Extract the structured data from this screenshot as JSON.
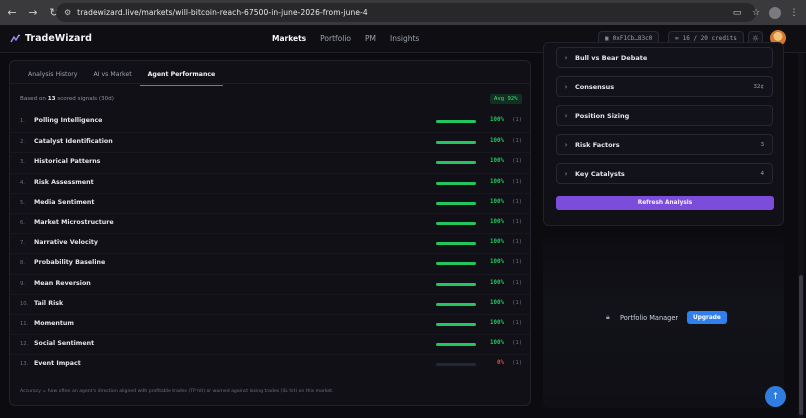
{
  "browser": {
    "url": "tradewizard.live/markets/will-bitcoin-reach-67500-in-june-2026-from-june-4"
  },
  "header": {
    "brand": "TradeWizard",
    "nav": [
      {
        "label": "Markets",
        "active": true
      },
      {
        "label": "Portfolio",
        "active": false
      },
      {
        "label": "PM",
        "active": false
      },
      {
        "label": "Insights",
        "active": false
      }
    ],
    "wallet": "0xF1Cb…83c0",
    "credits": "16 / 20 credits"
  },
  "tabs": [
    {
      "label": "Analysis History",
      "active": false
    },
    {
      "label": "AI vs Market",
      "active": false
    },
    {
      "label": "Agent Performance",
      "active": true
    }
  ],
  "summary": {
    "prefix": "Based on",
    "count": "13",
    "suffix": "scored signals (30d)",
    "avg_badge": "Avg 92%"
  },
  "agents": [
    {
      "num": "1.",
      "name": "Polling Intelligence",
      "pct": "100%",
      "fill": 1.0,
      "count": "(1)"
    },
    {
      "num": "2.",
      "name": "Catalyst Identification",
      "pct": "100%",
      "fill": 1.0,
      "count": "(1)"
    },
    {
      "num": "3.",
      "name": "Historical Patterns",
      "pct": "100%",
      "fill": 1.0,
      "count": "(1)"
    },
    {
      "num": "4.",
      "name": "Risk Assessment",
      "pct": "100%",
      "fill": 1.0,
      "count": "(1)"
    },
    {
      "num": "5.",
      "name": "Media Sentiment",
      "pct": "100%",
      "fill": 1.0,
      "count": "(1)"
    },
    {
      "num": "6.",
      "name": "Market Microstructure",
      "pct": "100%",
      "fill": 1.0,
      "count": "(1)"
    },
    {
      "num": "7.",
      "name": "Narrative Velocity",
      "pct": "100%",
      "fill": 1.0,
      "count": "(1)"
    },
    {
      "num": "8.",
      "name": "Probability Baseline",
      "pct": "100%",
      "fill": 1.0,
      "count": "(1)"
    },
    {
      "num": "9.",
      "name": "Mean Reversion",
      "pct": "100%",
      "fill": 1.0,
      "count": "(1)"
    },
    {
      "num": "10.",
      "name": "Tail Risk",
      "pct": "100%",
      "fill": 1.0,
      "count": "(1)"
    },
    {
      "num": "11.",
      "name": "Momentum",
      "pct": "100%",
      "fill": 1.0,
      "count": "(1)"
    },
    {
      "num": "12.",
      "name": "Social Sentiment",
      "pct": "100%",
      "fill": 1.0,
      "count": "(1)"
    },
    {
      "num": "13.",
      "name": "Event Impact",
      "pct": "0%",
      "fill": 0.0,
      "count": "(1)"
    }
  ],
  "footnote": "Accuracy = how often an agent's direction aligned with profitable trades (TP hit) or warned against losing trades (SL hit) on this market.",
  "sections": [
    {
      "label": "Bull vs Bear Debate",
      "value": ""
    },
    {
      "label": "Consensus",
      "value": "32¢"
    },
    {
      "label": "Position Sizing",
      "value": ""
    },
    {
      "label": "Risk Factors",
      "value": "3"
    },
    {
      "label": "Key Catalysts",
      "value": "4"
    }
  ],
  "refresh_label": "Refresh Analysis",
  "pm": {
    "label": "Portfolio Manager",
    "upgrade": "Upgrade"
  },
  "colors": {
    "accent": "#7c4ddb",
    "success": "#22c55e",
    "danger": "#ef4444",
    "upgrade": "#2f80ed"
  }
}
